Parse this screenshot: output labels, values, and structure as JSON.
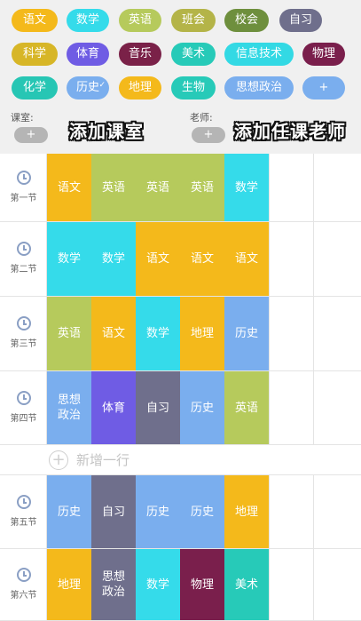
{
  "colors": {
    "yuwen": "#f4b91b",
    "shuxue": "#35dbea",
    "yingyu": "#b6ca5c",
    "banhui": "#b4b448",
    "xiaohui": "#6e8f3d",
    "zixi": "#6f6f8c",
    "kexue": "#d7b627",
    "tiyu": "#6f5ce4",
    "yinyue": "#7a2148",
    "meishu": "#27cab8",
    "xinxi": "#33d9e4",
    "wuli": "#7a1f4c",
    "huaxue": "#27c6b4",
    "lishi": "#7aaeee",
    "dili": "#f4b91b",
    "shengwu": "#27cab8",
    "sixiang": "#7aaeee",
    "add": "#7aaeee"
  },
  "subjects": [
    {
      "label": "语文",
      "color": "#f4b91b"
    },
    {
      "label": "数学",
      "color": "#35dbea"
    },
    {
      "label": "英语",
      "color": "#b6ca5c"
    },
    {
      "label": "班会",
      "color": "#b4b448"
    },
    {
      "label": "校会",
      "color": "#6e8f3d"
    },
    {
      "label": "自习",
      "color": "#6f6f8c"
    },
    {
      "label": "科学",
      "color": "#d7b627"
    },
    {
      "label": "体育",
      "color": "#6f5ce4"
    },
    {
      "label": "音乐",
      "color": "#7a2148"
    },
    {
      "label": "美术",
      "color": "#27cab8"
    },
    {
      "label": "信息技术",
      "color": "#33d9e4"
    },
    {
      "label": "物理",
      "color": "#7a1f4c"
    },
    {
      "label": "化学",
      "color": "#27c6b4"
    },
    {
      "label": "历史",
      "color": "#7aaeee"
    },
    {
      "label": "地理",
      "color": "#f4b91b"
    },
    {
      "label": "生物",
      "color": "#27cab8"
    },
    {
      "label": "思想政治",
      "color": "#7aaeee"
    },
    {
      "label": "+",
      "color": "#7aaeee"
    }
  ],
  "selected_subject_check": "✓",
  "fields": {
    "classroom_label": "课室:",
    "teacher_label": "老师:",
    "add_symbol": "+",
    "caption_classroom": "添加课室",
    "caption_teacher": "添加任课老师"
  },
  "add_row": {
    "icon": "+",
    "label": "新增一行"
  },
  "periods": [
    {
      "label": "第一节",
      "cells": [
        {
          "t": "语文",
          "c": "#f4b91b"
        },
        {
          "t": "英语",
          "c": "#b6ca5c"
        },
        {
          "t": "英语",
          "c": "#b6ca5c"
        },
        {
          "t": "英语",
          "c": "#b6ca5c"
        },
        {
          "t": "数学",
          "c": "#35dbea"
        }
      ]
    },
    {
      "label": "第二节",
      "cells": [
        {
          "t": "数学",
          "c": "#35dbea"
        },
        {
          "t": "数学",
          "c": "#35dbea"
        },
        {
          "t": "语文",
          "c": "#f4b91b"
        },
        {
          "t": "语文",
          "c": "#f4b91b"
        },
        {
          "t": "语文",
          "c": "#f4b91b"
        }
      ]
    },
    {
      "label": "第三节",
      "cells": [
        {
          "t": "英语",
          "c": "#b6ca5c"
        },
        {
          "t": "语文",
          "c": "#f4b91b"
        },
        {
          "t": "数学",
          "c": "#35dbea"
        },
        {
          "t": "地理",
          "c": "#f4b91b"
        },
        {
          "t": "历史",
          "c": "#7aaeee"
        }
      ]
    },
    {
      "label": "第四节",
      "cells": [
        {
          "t": "思想\n政治",
          "c": "#7aaeee"
        },
        {
          "t": "体育",
          "c": "#6f5ce4"
        },
        {
          "t": "自习",
          "c": "#6f6f8c"
        },
        {
          "t": "历史",
          "c": "#7aaeee"
        },
        {
          "t": "英语",
          "c": "#b6ca5c"
        }
      ]
    },
    {
      "label": "第五节",
      "cells": [
        {
          "t": "历史",
          "c": "#7aaeee"
        },
        {
          "t": "自习",
          "c": "#6f6f8c"
        },
        {
          "t": "历史",
          "c": "#7aaeee"
        },
        {
          "t": "历史",
          "c": "#7aaeee"
        },
        {
          "t": "地理",
          "c": "#f4b91b"
        }
      ]
    },
    {
      "label": "第六节",
      "cells": [
        {
          "t": "地理",
          "c": "#f4b91b"
        },
        {
          "t": "思想\n政治",
          "c": "#6f6f8c"
        },
        {
          "t": "数学",
          "c": "#35dbea"
        },
        {
          "t": "物理",
          "c": "#7a1f4c"
        },
        {
          "t": "美术",
          "c": "#27cab8"
        }
      ]
    }
  ]
}
